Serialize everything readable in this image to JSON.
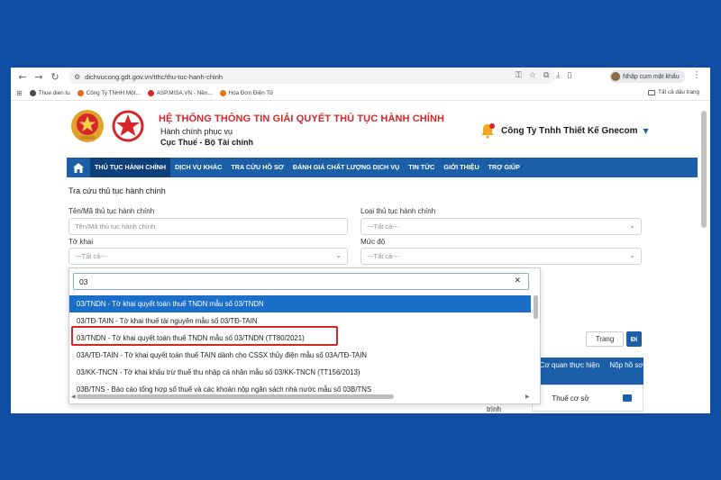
{
  "browser": {
    "url": "dichvucong.gdt.gov.vn/tthc/thu-tuc-hanh-chinh",
    "password_button": "Nhập cụm mật khẩu",
    "bookmarks": [
      {
        "label": "Thue dien tu",
        "color": "#4a4a4a"
      },
      {
        "label": "Công Ty TNHH Một...",
        "color": "#e06a1b"
      },
      {
        "label": "ASP.MISA.VN - Nền...",
        "color": "#d7262a"
      },
      {
        "label": "Hóa Đơn Điện Tử",
        "color": "#e8711b"
      }
    ],
    "all_bookmarks": "Tất cả dấu trang"
  },
  "site": {
    "title": "HỆ THỐNG THÔNG TIN GIẢI QUYẾT THỦ TỤC HÀNH CHÍNH",
    "subtitle1": "Hành chính phục vụ",
    "subtitle2": "Cục Thuế - Bộ Tài chính",
    "company": "Công Ty Tnhh Thiết Kế Gnecom"
  },
  "nav": [
    "THỦ TỤC HÀNH CHÍNH",
    "DỊCH VỤ KHÁC",
    "TRA CỨU HỒ SƠ",
    "ĐÁNH GIÁ CHẤT LƯỢNG DỊCH VỤ",
    "TIN TỨC",
    "GIỚI THIỆU",
    "TRỢ GIÚP"
  ],
  "form": {
    "title": "Tra cứu thủ tục hành chính",
    "name_label": "Tên/Mã thủ tục hành chính",
    "name_placeholder": "Tên/Mã thủ tục hành chính",
    "type_label": "Loại thủ tục hành chính",
    "type_value": "---Tất cả---",
    "form_label": "Tờ khai",
    "form_value": "---Tất cả---",
    "level_label": "Mức độ",
    "level_value": "---Tất cả---"
  },
  "dropdown": {
    "search_value": "03",
    "options": [
      "03/TNDN - Tờ khai quyết toán thuế TNDN mẫu số 03/TNDN",
      "03/TĐ-TAIN - Tờ khai thuế tài nguyên mẫu số 03/TĐ-TAIN",
      "03/TNDN - Tờ khai quyết toán thuế TNDN mẫu số 03/TNDN (TT80/2021)",
      "03A/TĐ-TAIN - Tờ khai quyết toán thuế TAIN dành cho CSSX thủy điện mẫu số 03A/TĐ-TAIN",
      "03/KK-TNCN - Tờ khai khấu trừ thuế thu nhập cá nhân mẫu số 03/KK-TNCN (TT156/2013)",
      "03B/TNS - Báo cáo tổng hợp số thuế và các khoản nộp ngân sách nhà nước mẫu số 03B/TNS"
    ],
    "highlighted_index": 0,
    "boxed_index": 2
  },
  "results": {
    "page_button": "Trang",
    "go_button": "Đi",
    "col_agency": "Cơ quan thực hiện",
    "col_submit": "Nộp hồ sơ",
    "row_agency": "Thuế cơ sở",
    "partial_text": "trình"
  },
  "colors": {
    "brand_blue": "#1b5fa8",
    "title_red": "#d7262a",
    "highlight": "#1b6fc8"
  }
}
